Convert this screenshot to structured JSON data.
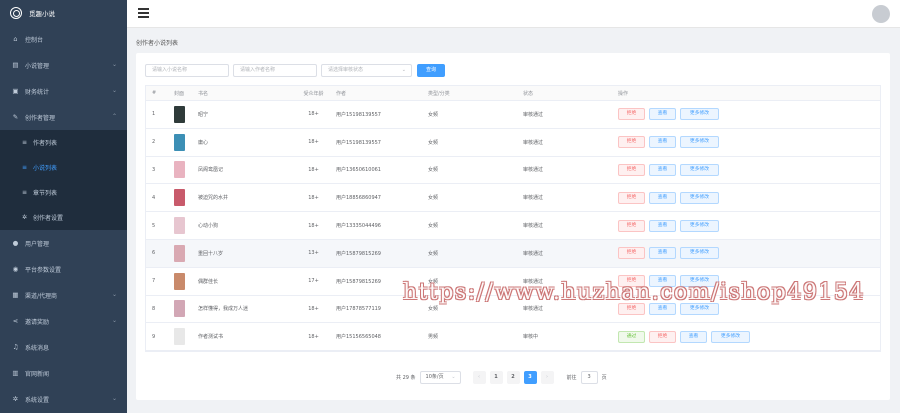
{
  "app": {
    "title": "觅趣小说"
  },
  "sidebar": {
    "items": [
      {
        "label": "控制台",
        "icon": "home-icon",
        "glyph": "⌂",
        "expandable": false
      },
      {
        "label": "小说管理",
        "icon": "book-icon",
        "glyph": "▤",
        "expandable": true
      },
      {
        "label": "财务统计",
        "icon": "wallet-icon",
        "glyph": "▣",
        "expandable": true
      },
      {
        "label": "创作者管理",
        "icon": "creator-icon",
        "glyph": "✎",
        "expandable": true,
        "expanded": true,
        "children": [
          {
            "label": "作者列表",
            "icon": "list-icon",
            "glyph": "≡",
            "active": false
          },
          {
            "label": "小说列表",
            "icon": "list-icon",
            "glyph": "≡",
            "active": true
          },
          {
            "label": "章节列表",
            "icon": "list-icon",
            "glyph": "≡",
            "active": false
          },
          {
            "label": "创作者设置",
            "icon": "gear-icon",
            "glyph": "✲",
            "active": false
          }
        ]
      },
      {
        "label": "用户管理",
        "icon": "user-icon",
        "glyph": "●",
        "expandable": false
      },
      {
        "label": "平台参数设置",
        "icon": "pin-icon",
        "glyph": "◉",
        "expandable": false
      },
      {
        "label": "渠道/代理商",
        "icon": "channel-icon",
        "glyph": "▦",
        "expandable": true
      },
      {
        "label": "邀请奖励",
        "icon": "share-icon",
        "glyph": "⋖",
        "expandable": true
      },
      {
        "label": "系统消息",
        "icon": "bell-icon",
        "glyph": "♫",
        "expandable": false
      },
      {
        "label": "官网新闻",
        "icon": "news-icon",
        "glyph": "▥",
        "expandable": false
      },
      {
        "label": "系统设置",
        "icon": "gear-icon",
        "glyph": "✲",
        "expandable": true
      }
    ]
  },
  "breadcrumb": "创作者小说列表",
  "filters": {
    "novel_placeholder": "请输入小说名称",
    "author_placeholder": "请输入作者名称",
    "status_placeholder": "请选择审核状态",
    "search_label": "查询"
  },
  "table": {
    "headers": [
      "#",
      "封面",
      "书名",
      "受众年龄",
      "作者",
      "类型/分类",
      "状态",
      "操作"
    ],
    "rows": [
      {
        "idx": "1",
        "cover": "#2f3b3a",
        "name": "昭宁",
        "age": "18+",
        "author": "用户15198139557",
        "category": "女频",
        "status": "审核通过",
        "ops": [
          "拒绝",
          "查看",
          "更多修改"
        ]
      },
      {
        "idx": "2",
        "cover": "#3c8fb5",
        "name": "庸心",
        "age": "18+",
        "author": "用户15198139557",
        "category": "女频",
        "status": "审核通过",
        "ops": [
          "拒绝",
          "查看",
          "更多修改"
        ]
      },
      {
        "idx": "3",
        "cover": "#e9b3c0",
        "name": "凤阁鸾凰记",
        "age": "18+",
        "author": "用户13650610061",
        "category": "女频",
        "status": "审核通过",
        "ops": [
          "拒绝",
          "查看",
          "更多修改"
        ]
      },
      {
        "idx": "4",
        "cover": "#c85a6b",
        "name": "被迫咒的水井",
        "age": "18+",
        "author": "用户18856860947",
        "category": "女频",
        "status": "审核通过",
        "ops": [
          "拒绝",
          "查看",
          "更多修改"
        ]
      },
      {
        "idx": "5",
        "cover": "#e7c6d0",
        "name": "心动小狗",
        "age": "18+",
        "author": "用户13335044496",
        "category": "女频",
        "status": "审核通过",
        "ops": [
          "拒绝",
          "查看",
          "更多修改"
        ]
      },
      {
        "idx": "6",
        "cover": "#d9a9b2",
        "name": "重回十八岁",
        "age": "13+",
        "author": "用户15879815269",
        "category": "女频",
        "status": "审核通过",
        "ops": [
          "拒绝",
          "查看",
          "更多修改"
        ]
      },
      {
        "idx": "7",
        "cover": "#c98a6b",
        "name": "偶群佳长",
        "age": "17+",
        "author": "用户15879815269",
        "category": "女频",
        "status": "审核通过",
        "ops": [
          "拒绝",
          "查看",
          "更多修改"
        ]
      },
      {
        "idx": "8",
        "cover": "#d2a7b5",
        "name": "怎样懂得，我成万人迷",
        "age": "18+",
        "author": "用户17878577119",
        "category": "女频",
        "status": "审核通过",
        "ops": [
          "拒绝",
          "查看",
          "更多修改"
        ]
      },
      {
        "idx": "9",
        "cover": "#e8e8e8",
        "name": "作者测试书",
        "age": "18+",
        "author": "用户15156565048",
        "category": "男频",
        "status": "审核中",
        "ops": [
          "通过",
          "拒绝",
          "查看",
          "更多修改"
        ]
      }
    ]
  },
  "pagination": {
    "total": "共 29 条",
    "page_size": "10条/页",
    "prev": "‹",
    "pages": [
      "1",
      "2",
      "3"
    ],
    "current": "3",
    "next": "›",
    "goto_label": "前往",
    "goto_value": "3",
    "goto_unit": "页"
  },
  "watermark": "https://www.huzhan.com/ishop49154",
  "colors": {
    "sidebar_bg": "#304156",
    "accent": "#409eff",
    "danger": "#f56c6c",
    "success": "#67c23a"
  }
}
